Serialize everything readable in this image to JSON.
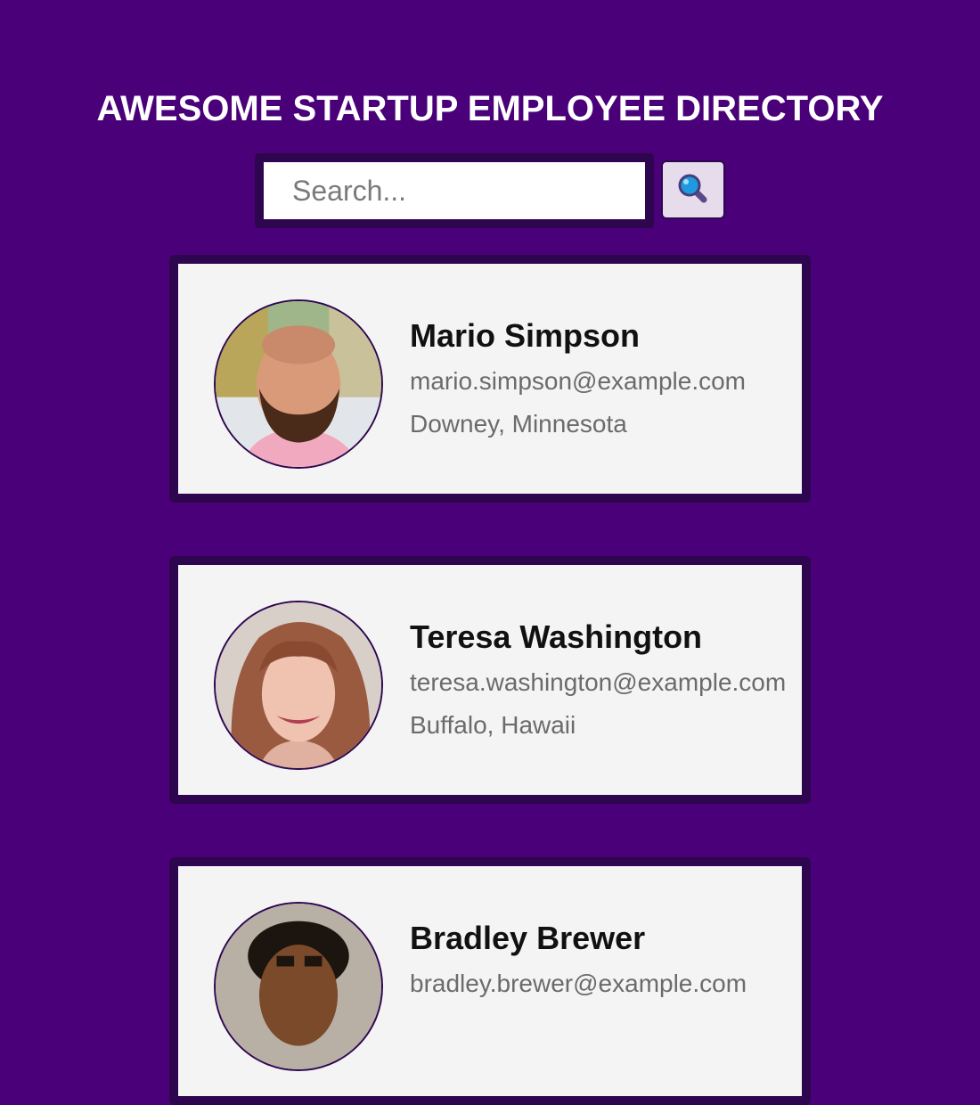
{
  "header": {
    "title": "AWESOME STARTUP EMPLOYEE DIRECTORY"
  },
  "search": {
    "placeholder": "Search...",
    "value": "",
    "button_icon": "magnifying-glass-icon"
  },
  "colors": {
    "background": "#4a0078",
    "card_border": "#2e0650",
    "card_background": "#f4f4f4",
    "search_button_background": "#e6dcec"
  },
  "employees": [
    {
      "name": "Mario Simpson",
      "email": "mario.simpson@example.com",
      "location": "Downey, Minnesota"
    },
    {
      "name": "Teresa Washington",
      "email": "teresa.washington@example.com",
      "location": "Buffalo, Hawaii"
    },
    {
      "name": "Bradley Brewer",
      "email": "bradley.brewer@example.com",
      "location": ""
    }
  ]
}
